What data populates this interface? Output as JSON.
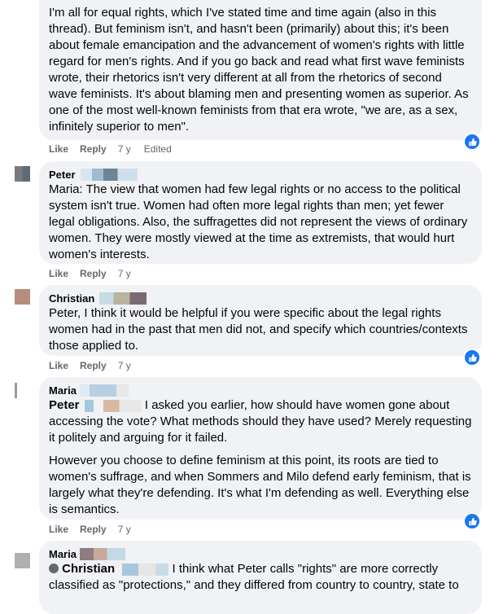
{
  "actions": {
    "like": "Like",
    "reply": "Reply",
    "age": "7 y",
    "edited": "Edited"
  },
  "comments": [
    {
      "name": "",
      "text": "I'm all for equal rights, which I've stated time and time again (also in this thread). But feminism isn't, and hasn't been (primarily) about this; it's been about female emancipation and the advancement of women's rights with little regard for men's rights. And if you go back and read what first wave feminists wrote, their rhetorics isn't very different at all from the rhetorics of second wave feminists. It's about blaming men and presenting women as superior. As one of the most well-known feminists from that era wrote, \"we are, as a sex, infinitely superior to men\"."
    },
    {
      "name": "Peter",
      "text": "Maria: The view that women had few legal rights or no access to the political system isn't true. Women had often more legal rights than men; yet fewer legal obligations. Also, the suffragettes did not represent the views of ordinary women. They were mostly viewed at the time as extremists, that would hurt women's interests."
    },
    {
      "name": "Christian",
      "text": "Peter, I think it would be helpful if you were specific about the legal rights women had in the past that men did not, and specify which countries/contexts those applied to."
    },
    {
      "name": "Maria",
      "mention": "Peter",
      "text1": "I asked you earlier, how should have women gone about accessing the vote? What methods should they have used? Merely requesting it politely and arguing for it failed.",
      "text2": "However you choose to define feminism at this point, its roots are tied to women's suffrage, and when Sommers and Milo defend early feminism, that is largely what they're defending. It's what I'm defending as well. Everything else is semantics."
    },
    {
      "name": "Maria",
      "mention": "Christian",
      "text": "I think what Peter calls \"rights\" are more correctly classified as \"protections,\" and they differed from country to country, state to"
    }
  ],
  "colors": {
    "bubble": "#f0f2f5",
    "like_blue": "#1877f2",
    "meta": "#65676b"
  }
}
